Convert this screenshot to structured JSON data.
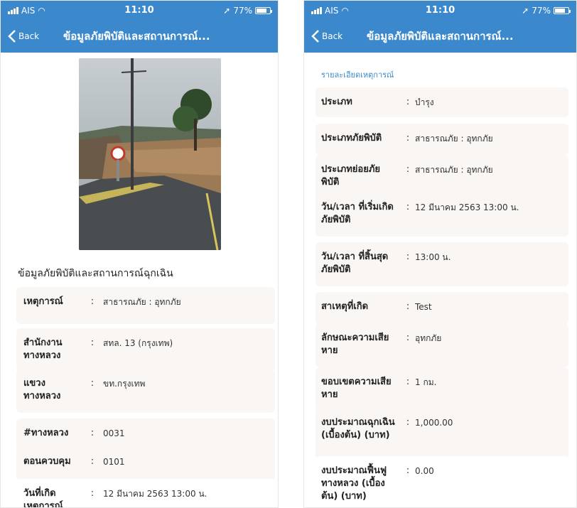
{
  "status": {
    "carrier": "AIS",
    "time": "11:10",
    "battery": "77%"
  },
  "nav": {
    "back_label": "Back",
    "title": "ข้อมูลภัยพิบัติและสถานการณ์..."
  },
  "left": {
    "section_title": "ข้อมูลภัยพิบัติและสถานการณ์ฉุกเฉิน",
    "rows": [
      {
        "label": "เหตุการณ์",
        "value": "สาธารณภัย : อุทกภัย"
      },
      {
        "label": "สำนักงาน ทางหลวง",
        "value": "สทล. 13 (กรุงเทพ)"
      },
      {
        "label": "แขวง ทางหลวง",
        "value": "ขท.กรุงเทพ"
      },
      {
        "label": "#ทางหลวง",
        "value": "0031"
      },
      {
        "label": "ตอนควบคุม",
        "value": "0101"
      },
      {
        "label": "วันที่เกิด เหตุการณ์",
        "value": "12 มีนาคม 2563 13:00 น."
      }
    ]
  },
  "right": {
    "section_title": "รายละเอียดเหตุการณ์",
    "rows": [
      {
        "label": "ประเภท",
        "value": "บำรุง"
      },
      {
        "label": "ประเภทภัยพิบัติ",
        "value": "สาธารณภัย : อุทกภัย"
      },
      {
        "label": "ประเภทย่อยภัย พิบัติ",
        "value": "สาธารณภัย : อุทกภัย"
      },
      {
        "label": "วัน/เวลา ที่เริ่มเกิด ภัยพิบัติ",
        "value": "12 มีนาคม 2563 13:00 น."
      },
      {
        "label": "วัน/เวลา ที่สิ้นสุด ภัยพิบัติ",
        "value": "13:00 น."
      },
      {
        "label": "สาเหตุที่เกิด",
        "value": "Test"
      },
      {
        "label": "ลักษณะความเสีย หาย",
        "value": "อุทกภัย"
      },
      {
        "label": "ขอบเขตความเสีย หาย",
        "value": "1 กม."
      },
      {
        "label": "งบประมาณฉุกเฉิน (เบื้องต้น) (บาท)",
        "value": "1,000.00"
      },
      {
        "label": "งบประมาณฟื้นฟู ทางหลวง (เบื้อง ต้น) (บาท)",
        "value": "0.00"
      }
    ]
  },
  "colors": {
    "nav_blue": "#3b88cc",
    "row_bg": "#f9f6f3",
    "accent_text": "#3b88cc"
  }
}
